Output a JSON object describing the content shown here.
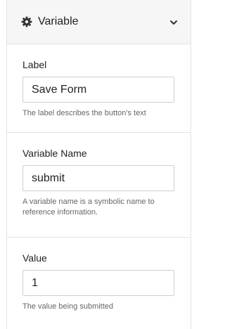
{
  "panel": {
    "title": "Variable",
    "icons": {
      "title_icon": "gear-icon",
      "collapse_icon": "chevron-down-icon"
    }
  },
  "fields": [
    {
      "label": "Label",
      "value": "Save Form",
      "help": "The label describes the button's text"
    },
    {
      "label": "Variable Name",
      "value": "submit",
      "help": "A variable name is a symbolic name to reference information."
    },
    {
      "label": "Value",
      "value": "1",
      "help": "The value being submitted"
    }
  ]
}
